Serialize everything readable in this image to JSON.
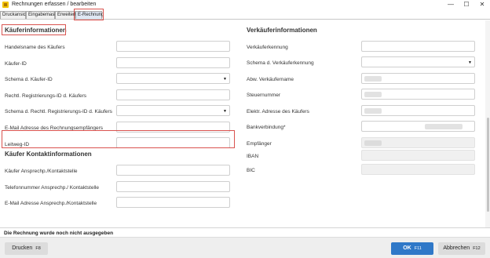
{
  "window": {
    "title": "Rechnungen erfassen / bearbeiten",
    "minimize_glyph": "—",
    "maximize_glyph": "☐",
    "close_glyph": "✕"
  },
  "tabs": [
    {
      "label": "Druckansicht",
      "active": false
    },
    {
      "label": "Eingabemaske",
      "active": false
    },
    {
      "label": "Erweitert",
      "active": false
    },
    {
      "label": "E-Rechnung",
      "active": true
    }
  ],
  "buyer": {
    "section_title": "Käuferinformationen",
    "fields": {
      "name": {
        "label": "Handelsname des Käufers",
        "value": ""
      },
      "id": {
        "label": "Käufer-ID",
        "value": ""
      },
      "scheme": {
        "label": "Schema d. Käufer-ID",
        "value": ""
      },
      "reg_id": {
        "label": "Rechtl. Registrierungs-ID d. Käufers",
        "value": ""
      },
      "reg_scheme": {
        "label": "Schema d. Rechtl. Registrierungs-ID d. Käufers",
        "value": ""
      },
      "email": {
        "label": "E-Mail Adresse des Rechnungsempfängers",
        "value": ""
      },
      "leitweg": {
        "label": "Leitweg-ID",
        "value": ""
      }
    }
  },
  "buyer_contact": {
    "section_title": "Käufer Kontaktinformationen",
    "fields": {
      "contact": {
        "label": "Käufer Ansprechp./Kontaktstelle",
        "value": ""
      },
      "phone": {
        "label": "Telefonnummer Ansprechp./ Kontaktstelle",
        "value": ""
      },
      "email": {
        "label": "E-Mail Adresse Ansprechp./Kontaktstelle",
        "value": ""
      }
    }
  },
  "seller": {
    "section_title": "Verkäuferinformationen",
    "fields": {
      "kennung": {
        "label": "Verkäuferkennung",
        "value": ""
      },
      "scheme": {
        "label": "Schema d. Verkäuferkennung",
        "value": ""
      },
      "abw_name": {
        "label": "Abw. Verkäufername",
        "value": ""
      },
      "tax": {
        "label": "Steuernummer",
        "value": ""
      },
      "elektr": {
        "label": "Elektr. Adresse des Käufers",
        "value": ""
      },
      "bank": {
        "label": "Bankverbindung*",
        "value": ""
      },
      "recipient": {
        "label": "Empfänger",
        "value": ""
      },
      "iban": {
        "label": "IBAN",
        "value": ""
      },
      "bic": {
        "label": "BIC",
        "value": ""
      }
    }
  },
  "status": {
    "text": "Die Rechnung wurde noch nicht ausgegeben"
  },
  "buttons": {
    "print": {
      "label": "Drucken",
      "key": "F8"
    },
    "ok": {
      "label": "OK",
      "key": "F11"
    },
    "cancel": {
      "label": "Abbrechen",
      "key": "F12"
    }
  },
  "icons": {
    "app": "app-icon",
    "dropdown": "chevron-down-icon",
    "dropdown_glyph": "▼"
  },
  "colors": {
    "highlight": "#d9534f",
    "ok_button": "#2f78c8",
    "active_tab": "#dfe7f3"
  }
}
